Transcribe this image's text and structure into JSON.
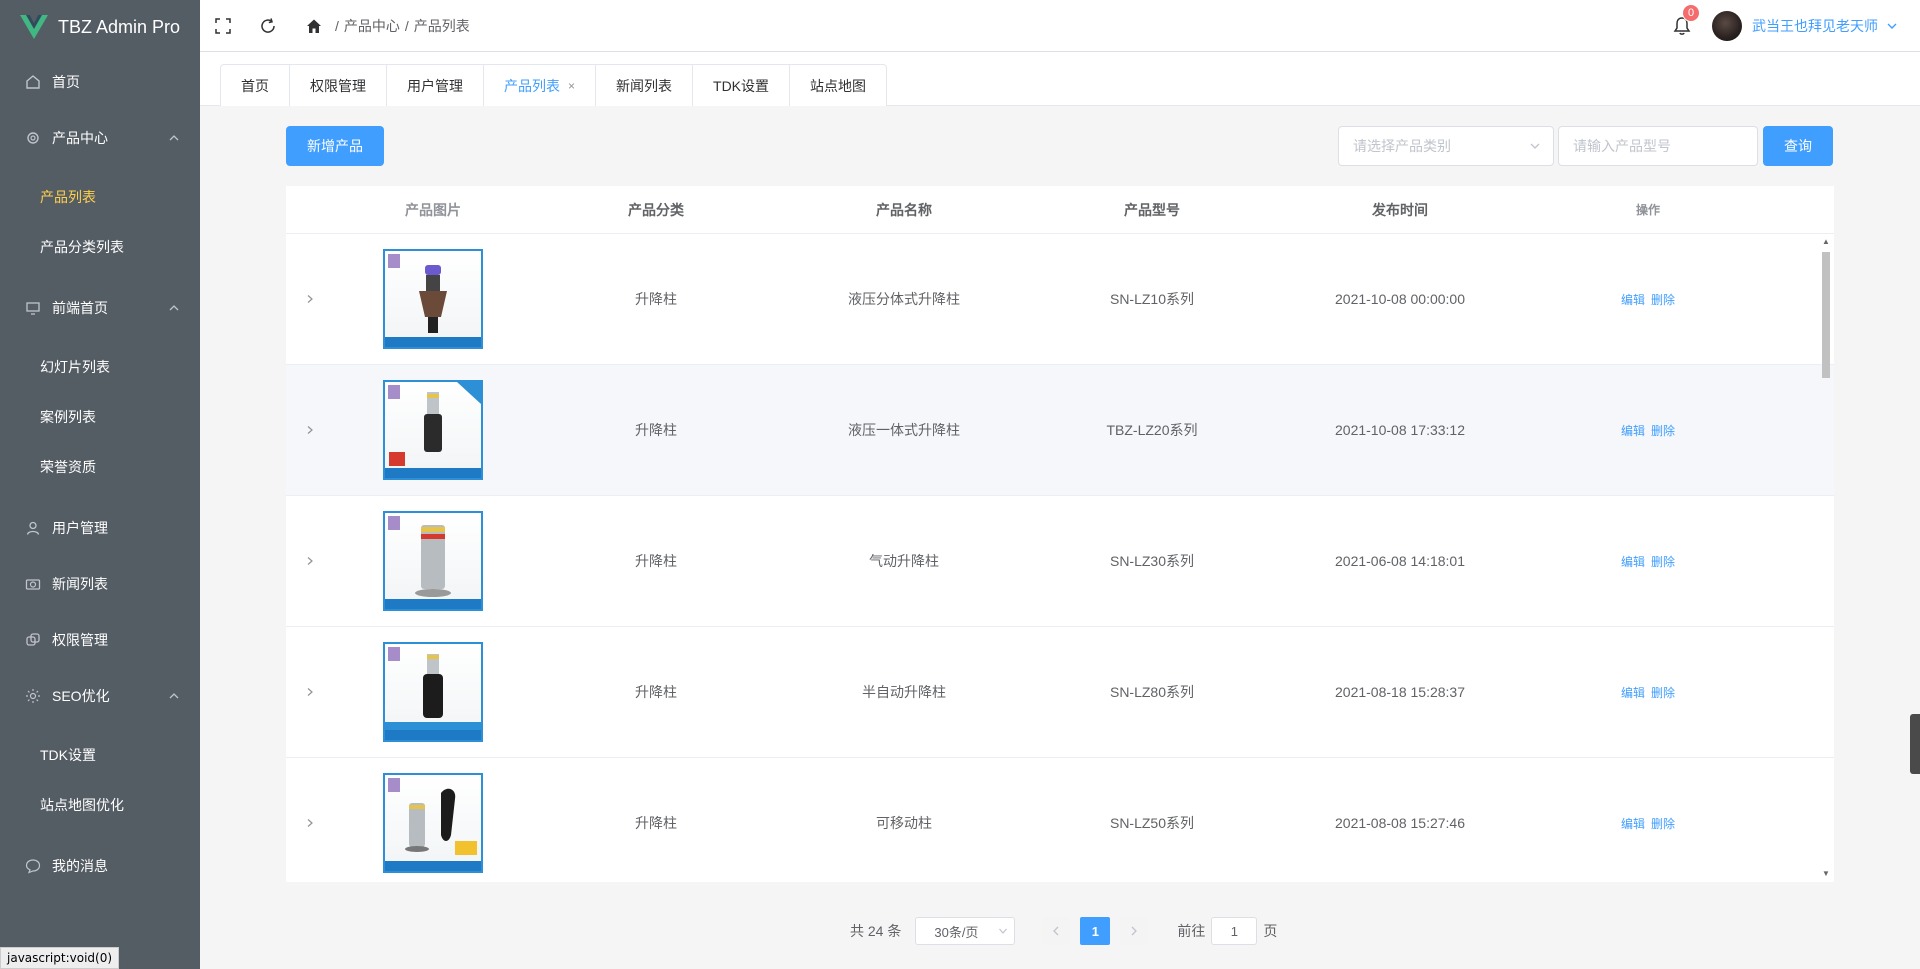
{
  "app": {
    "title": "TBZ Admin Pro"
  },
  "sidebar": {
    "items": [
      {
        "label": "首页",
        "icon": "home-icon"
      },
      {
        "label": "产品中心",
        "icon": "gear-icon",
        "children": [
          "产品列表",
          "产品分类列表"
        ]
      },
      {
        "label": "前端首页",
        "icon": "monitor-icon",
        "children": [
          "幻灯片列表",
          "案例列表",
          "荣誉资质"
        ]
      },
      {
        "label": "用户管理",
        "icon": "user-icon"
      },
      {
        "label": "新闻列表",
        "icon": "camera-icon"
      },
      {
        "label": "权限管理",
        "icon": "copy-icon"
      },
      {
        "label": "SEO优化",
        "icon": "sun-icon",
        "children": [
          "TDK设置",
          "站点地图优化"
        ]
      },
      {
        "label": "我的消息",
        "icon": "chat-icon"
      }
    ],
    "active_child": "产品列表",
    "status_text": "javascript:void(0)"
  },
  "header": {
    "breadcrumb": [
      "产品中心",
      "产品列表"
    ],
    "notification_count": "0",
    "user_name": "武当王也拜见老天师"
  },
  "tabs": [
    {
      "label": "首页"
    },
    {
      "label": "权限管理"
    },
    {
      "label": "用户管理"
    },
    {
      "label": "产品列表",
      "active": true,
      "close": "×"
    },
    {
      "label": "新闻列表"
    },
    {
      "label": "TDK设置"
    },
    {
      "label": "站点地图"
    }
  ],
  "toolbar": {
    "add_label": "新增产品",
    "category_placeholder": "请选择产品类别",
    "model_placeholder": "请输入产品型号",
    "search_label": "查询"
  },
  "table": {
    "columns": [
      "产品图片",
      "产品分类",
      "产品名称",
      "产品型号",
      "发布时间",
      "操作"
    ],
    "rows": [
      {
        "category": "升降柱",
        "name": "液压分体式升降柱",
        "model": "SN-LZ10系列",
        "time": "2021-10-08 00:00:00"
      },
      {
        "category": "升降柱",
        "name": "液压一体式升降柱",
        "model": "TBZ-LZ20系列",
        "time": "2021-10-08 17:33:12"
      },
      {
        "category": "升降柱",
        "name": "气动升降柱",
        "model": "SN-LZ30系列",
        "time": "2021-06-08 14:18:01"
      },
      {
        "category": "升降柱",
        "name": "半自动升降柱",
        "model": "SN-LZ80系列",
        "time": "2021-08-18 15:28:37"
      },
      {
        "category": "升降柱",
        "name": "可移动柱",
        "model": "SN-LZ50系列",
        "time": "2021-08-08 15:27:46"
      }
    ],
    "edit_label": "编辑",
    "delete_label": "删除"
  },
  "pagination": {
    "total_text": "共 24 条",
    "page_size": "30条/页",
    "current_page": "1",
    "goto_prefix": "前往",
    "goto_value": "1",
    "goto_suffix": "页"
  },
  "colors": {
    "primary": "#409eff",
    "sidebar_bg": "#545c64",
    "active_menu": "#ffd04b",
    "badge": "#f56c6c"
  }
}
